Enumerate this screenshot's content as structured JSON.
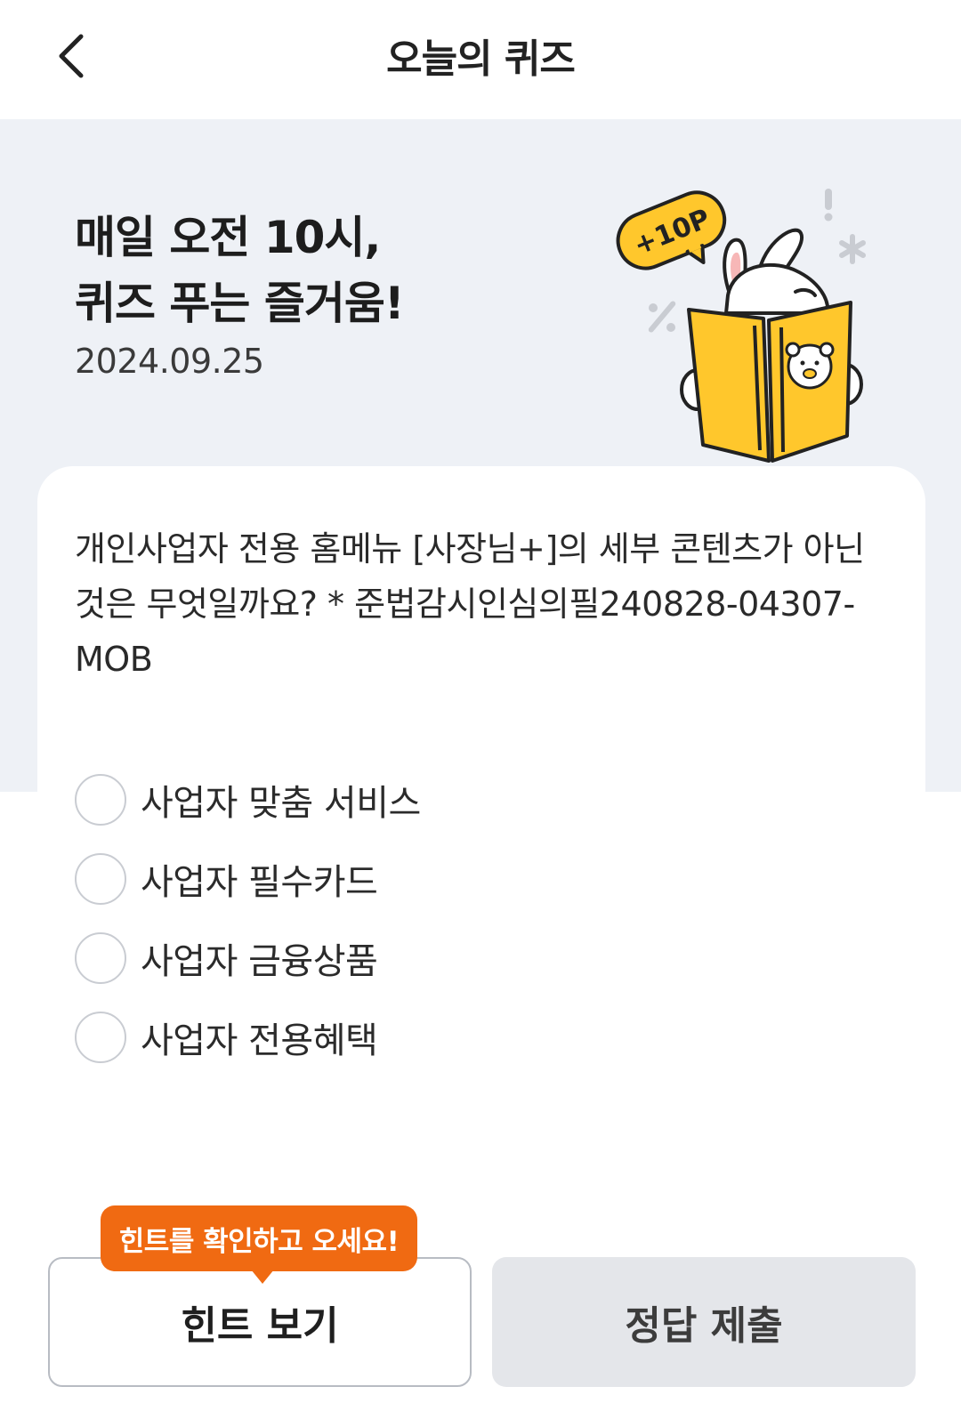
{
  "header": {
    "title": "오늘의 퀴즈",
    "back_icon": "chevron-left-icon"
  },
  "hero": {
    "title": "매일 오전 10시,\n퀴즈 푸는 즐거움!",
    "date": "2024.09.25",
    "badge_text": "+10P"
  },
  "quiz": {
    "question": "개인사업자 전용 홈메뉴 [사장님+]의 세부 콘텐츠가 아닌 것은 무엇일까요? * 준법감시인심의필240828-04307-MOB",
    "options": [
      {
        "label": "사업자 맞춤 서비스"
      },
      {
        "label": "사업자 필수카드"
      },
      {
        "label": "사업자 금융상품"
      },
      {
        "label": "사업자 전용혜택"
      }
    ]
  },
  "buttons": {
    "hint_label": "힌트 보기",
    "submit_label": "정답 제출",
    "hint_tooltip": "힌트를 확인하고 오세요!"
  },
  "colors": {
    "hero_bg": "#eef1f6",
    "accent_orange": "#f06a12",
    "book_yellow": "#ffc72c",
    "submit_bg": "#e4e6ea"
  }
}
